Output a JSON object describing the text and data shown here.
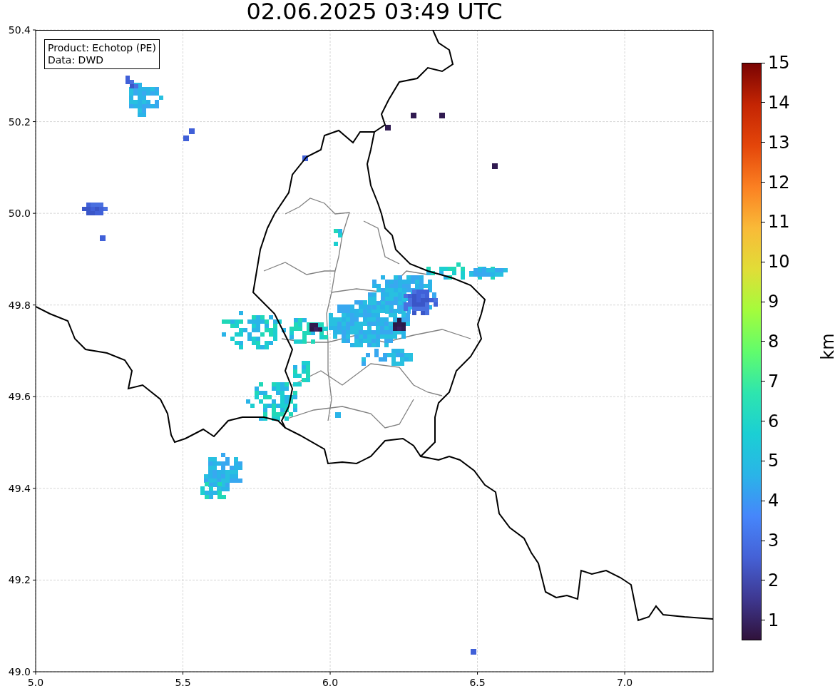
{
  "title": "02.06.2025 03:49 UTC",
  "info_box": {
    "lines": [
      "Product: Echotop (PE)",
      "Data: DWD"
    ]
  },
  "axes": {
    "xticks": [
      "5.0",
      "5.5",
      "6.0",
      "6.5",
      "7.0"
    ],
    "yticks": [
      "50.4",
      "50.2",
      "50.0",
      "49.8",
      "49.6",
      "49.4",
      "49.2",
      "49.0"
    ]
  },
  "colorbar": {
    "label": "km",
    "ticks": [
      "15",
      "14",
      "13",
      "12",
      "11",
      "10",
      "9",
      "8",
      "7",
      "6",
      "5",
      "4",
      "3",
      "2",
      "1"
    ]
  }
}
